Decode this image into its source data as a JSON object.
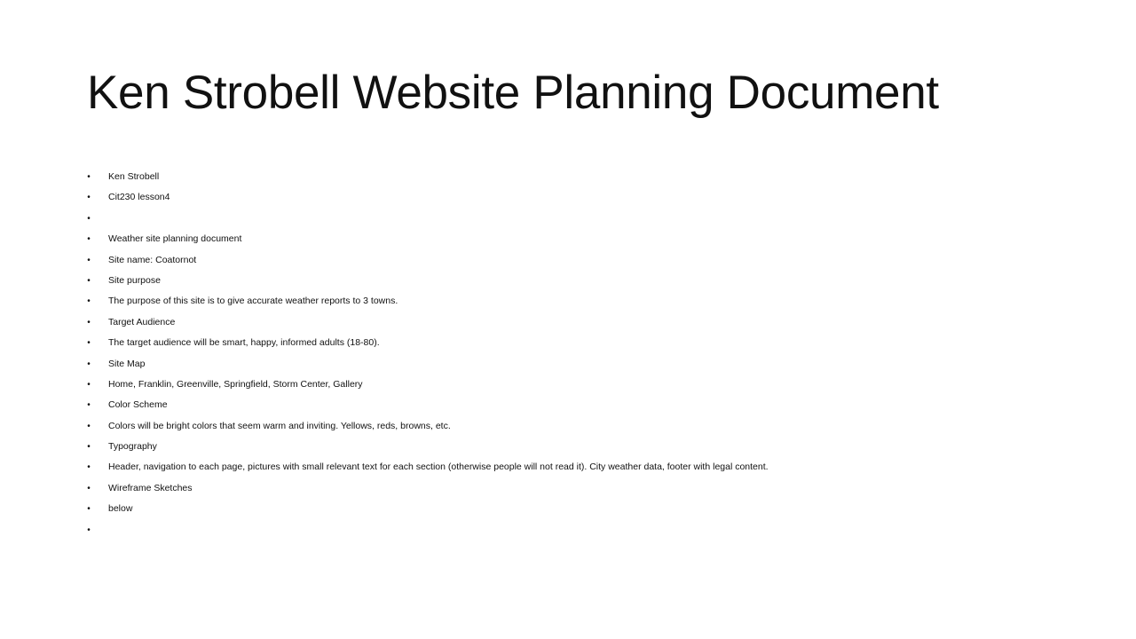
{
  "title": "Ken Strobell Website Planning Document",
  "bullet_glyph": "•",
  "items": [
    "Ken Strobell",
    "Cit230 lesson4",
    "",
    "Weather site planning document",
    "Site name: Coatornot",
    "Site purpose",
    "The purpose of this site is to give accurate weather reports to 3 towns.",
    "Target Audience",
    "The target audience will be smart, happy, informed adults (18-80).",
    "Site Map",
    "Home, Franklin, Greenville, Springfield, Storm Center, Gallery",
    "Color Scheme",
    "Colors will be bright colors that seem warm and inviting. Yellows, reds, browns, etc.",
    "Typography",
    "Header, navigation to each page, pictures with small relevant text for each section (otherwise people will not read it). City weather data, footer with legal content.",
    "Wireframe Sketches",
    "below",
    ""
  ]
}
